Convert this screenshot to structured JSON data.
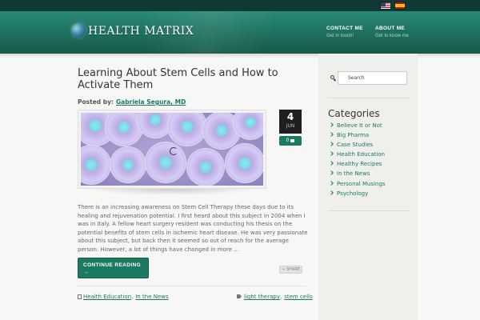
{
  "header": {
    "brand": "HEALTH MATRIX",
    "nav": [
      {
        "title": "CONTACT ME",
        "subtitle": "Get in touch!"
      },
      {
        "title": "ABOUT ME",
        "subtitle": "Get to know me"
      }
    ],
    "language_flags": [
      "us-flag-icon",
      "spain-flag-icon"
    ]
  },
  "post": {
    "title": "Learning About Stem Cells and How to Activate Them",
    "posted_by_label": "Posted by:",
    "author": "Gabriela Segura, MD",
    "date_day": "4",
    "date_month": "JUN",
    "comment_count": "0",
    "excerpt": "There is an increasing awareness on Stem Cell Therapy these days due to its healing and rejuvenation potential. I first heard about this subject in 2004 when I was in Italy. A fellow heart surgery resident was conducting his thesis on the potential benefits of stem cells in ischemic heart disease. He was very passionate about this subject, but back then it seemed so out of reach for the average person. However, a lot of things have changed in more …",
    "continue_label": "CONTINUE READING →",
    "share_label": "SHARE",
    "categories": [
      "Health Education",
      "In the News"
    ],
    "tags": [
      "light therapy",
      "stem cells"
    ]
  },
  "sidebar": {
    "search_placeholder": "Search",
    "categories_heading": "Categories",
    "categories": [
      "Believe It or Not",
      "Big Pharma",
      "Case Studies",
      "Health Education",
      "Healthy Recipes",
      "In the News",
      "Personal Musings",
      "Psychology"
    ]
  },
  "colors": {
    "header_green": "#1d6e5e",
    "accent_green": "#1d7a62",
    "top_bar": "#0f3a33",
    "date_box": "#1f1f1f"
  }
}
